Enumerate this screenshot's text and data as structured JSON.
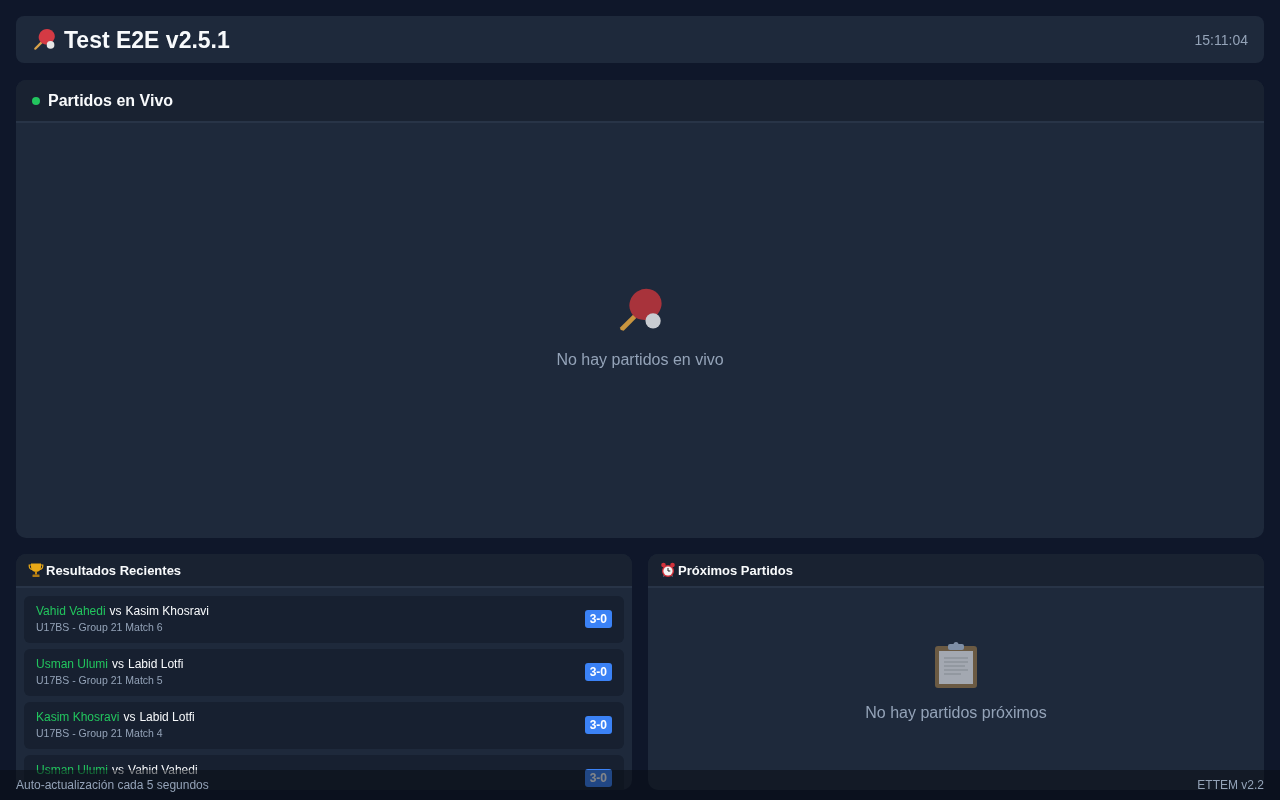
{
  "header": {
    "title": "Test E2E v2.5.1",
    "clock": "15:11:04"
  },
  "live_panel": {
    "title": "Partidos en Vivo",
    "empty_message": "No hay partidos en vivo"
  },
  "recent_results": {
    "title": "Resultados Recientes",
    "rows": [
      {
        "winner": "Vahid Vahedi",
        "separator": "vs",
        "loser": "Kasim Khosravi",
        "meta": "U17BS - Group 21 Match 6",
        "score": "3-0"
      },
      {
        "winner": "Usman Ulumi",
        "separator": "vs",
        "loser": "Labid Lotfi",
        "meta": "U17BS - Group 21 Match 5",
        "score": "3-0"
      },
      {
        "winner": "Kasim Khosravi",
        "separator": "vs",
        "loser": "Labid Lotfi",
        "meta": "U17BS - Group 21 Match 4",
        "score": "3-0"
      },
      {
        "winner": "Usman Ulumi",
        "separator": "vs",
        "loser": "Vahid Vahedi",
        "score": "3-0"
      }
    ]
  },
  "upcoming": {
    "title": "Próximos Partidos",
    "empty_message": "No hay partidos próximos"
  },
  "footer": {
    "left": "Auto-actualización cada 5 segundos",
    "right": "ETTEM v2.2"
  }
}
